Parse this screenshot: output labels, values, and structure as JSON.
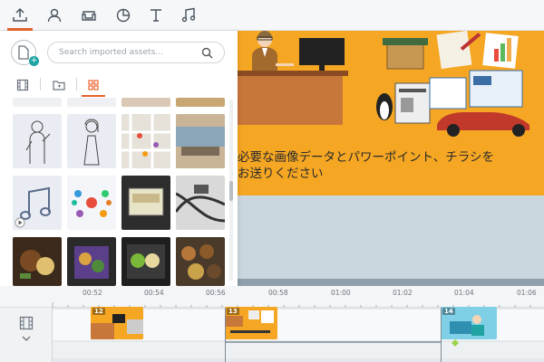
{
  "toolbar": {
    "tools": [
      "upload",
      "characters",
      "props",
      "charts",
      "text",
      "audio"
    ],
    "active": "upload"
  },
  "assets_panel": {
    "search_placeholder": "Search imported assets...",
    "tabs": [
      "video",
      "folder",
      "grid"
    ],
    "active_tab": "grid",
    "thumbnails": [
      "businessman-sketch",
      "businesswoman-sketch",
      "map-thumbnail",
      "office-photo",
      "music-note-audio",
      "mind-map-thumbnail",
      "lunch-box-photo",
      "cables-photo",
      "bento-photo-1",
      "bento-photo-2",
      "bento-photo-3",
      "food-photo-4"
    ]
  },
  "stage": {
    "caption_line1": "必要な画像データとパワーポイント、チラシを",
    "caption_line2": "お送りください",
    "background": "#f5a623"
  },
  "timeline": {
    "ticks": [
      "00:52",
      "00:54",
      "00:56",
      "00:58",
      "01:00",
      "01:02",
      "01:04",
      "01:06"
    ],
    "clips": [
      {
        "number": "12"
      },
      {
        "number": "13"
      },
      {
        "number": "14"
      }
    ]
  },
  "colors": {
    "accent": "#e8632c",
    "stage_orange": "#f5a623",
    "teal": "#1fa3a3"
  }
}
